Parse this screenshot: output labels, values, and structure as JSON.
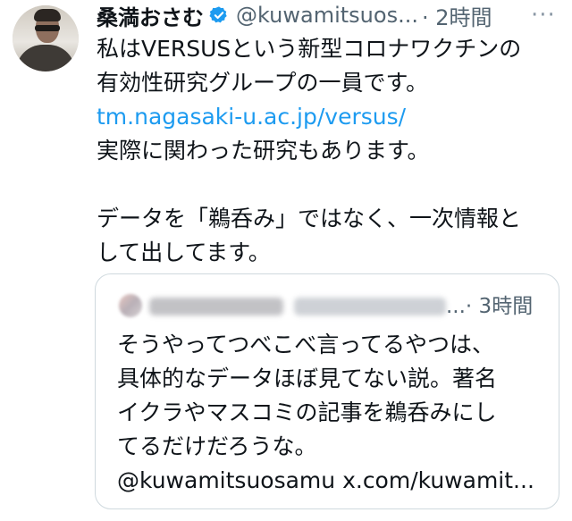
{
  "tweet": {
    "author_name": "桑満おさむ",
    "handle": "@kuwamitsuos...",
    "time": "· 2時間",
    "more_label": "···",
    "lines": [
      "私はVERSUSという新型コロナワクチンの",
      "有効性研究グループの一員です。",
      "tm.nagasaki-u.ac.jp/versus/",
      "実際に関わった研究もあります。",
      "",
      "データを「鵜呑み」ではなく、一次情報と",
      "して出してます。"
    ],
    "link": "tm.nagasaki-u.ac.jp/versus/"
  },
  "quoted": {
    "meta": "...· 3時間",
    "lines": [
      "そうやってつべこべ言ってるやつは、",
      "具体的なデータほぼ見てない説。著名",
      "イクラやマスコミの記事を鵜呑みにし",
      "てるだけだろうな。",
      "@kuwamitsuosamu x.com/kuwamit..."
    ]
  },
  "colors": {
    "link": "#1d9bf0",
    "verified": "#1d9bf0",
    "secondary_text": "#536471",
    "border": "#cfd9de"
  },
  "icons": {
    "verified": "verified-badge-icon",
    "more": "more-options-icon"
  }
}
